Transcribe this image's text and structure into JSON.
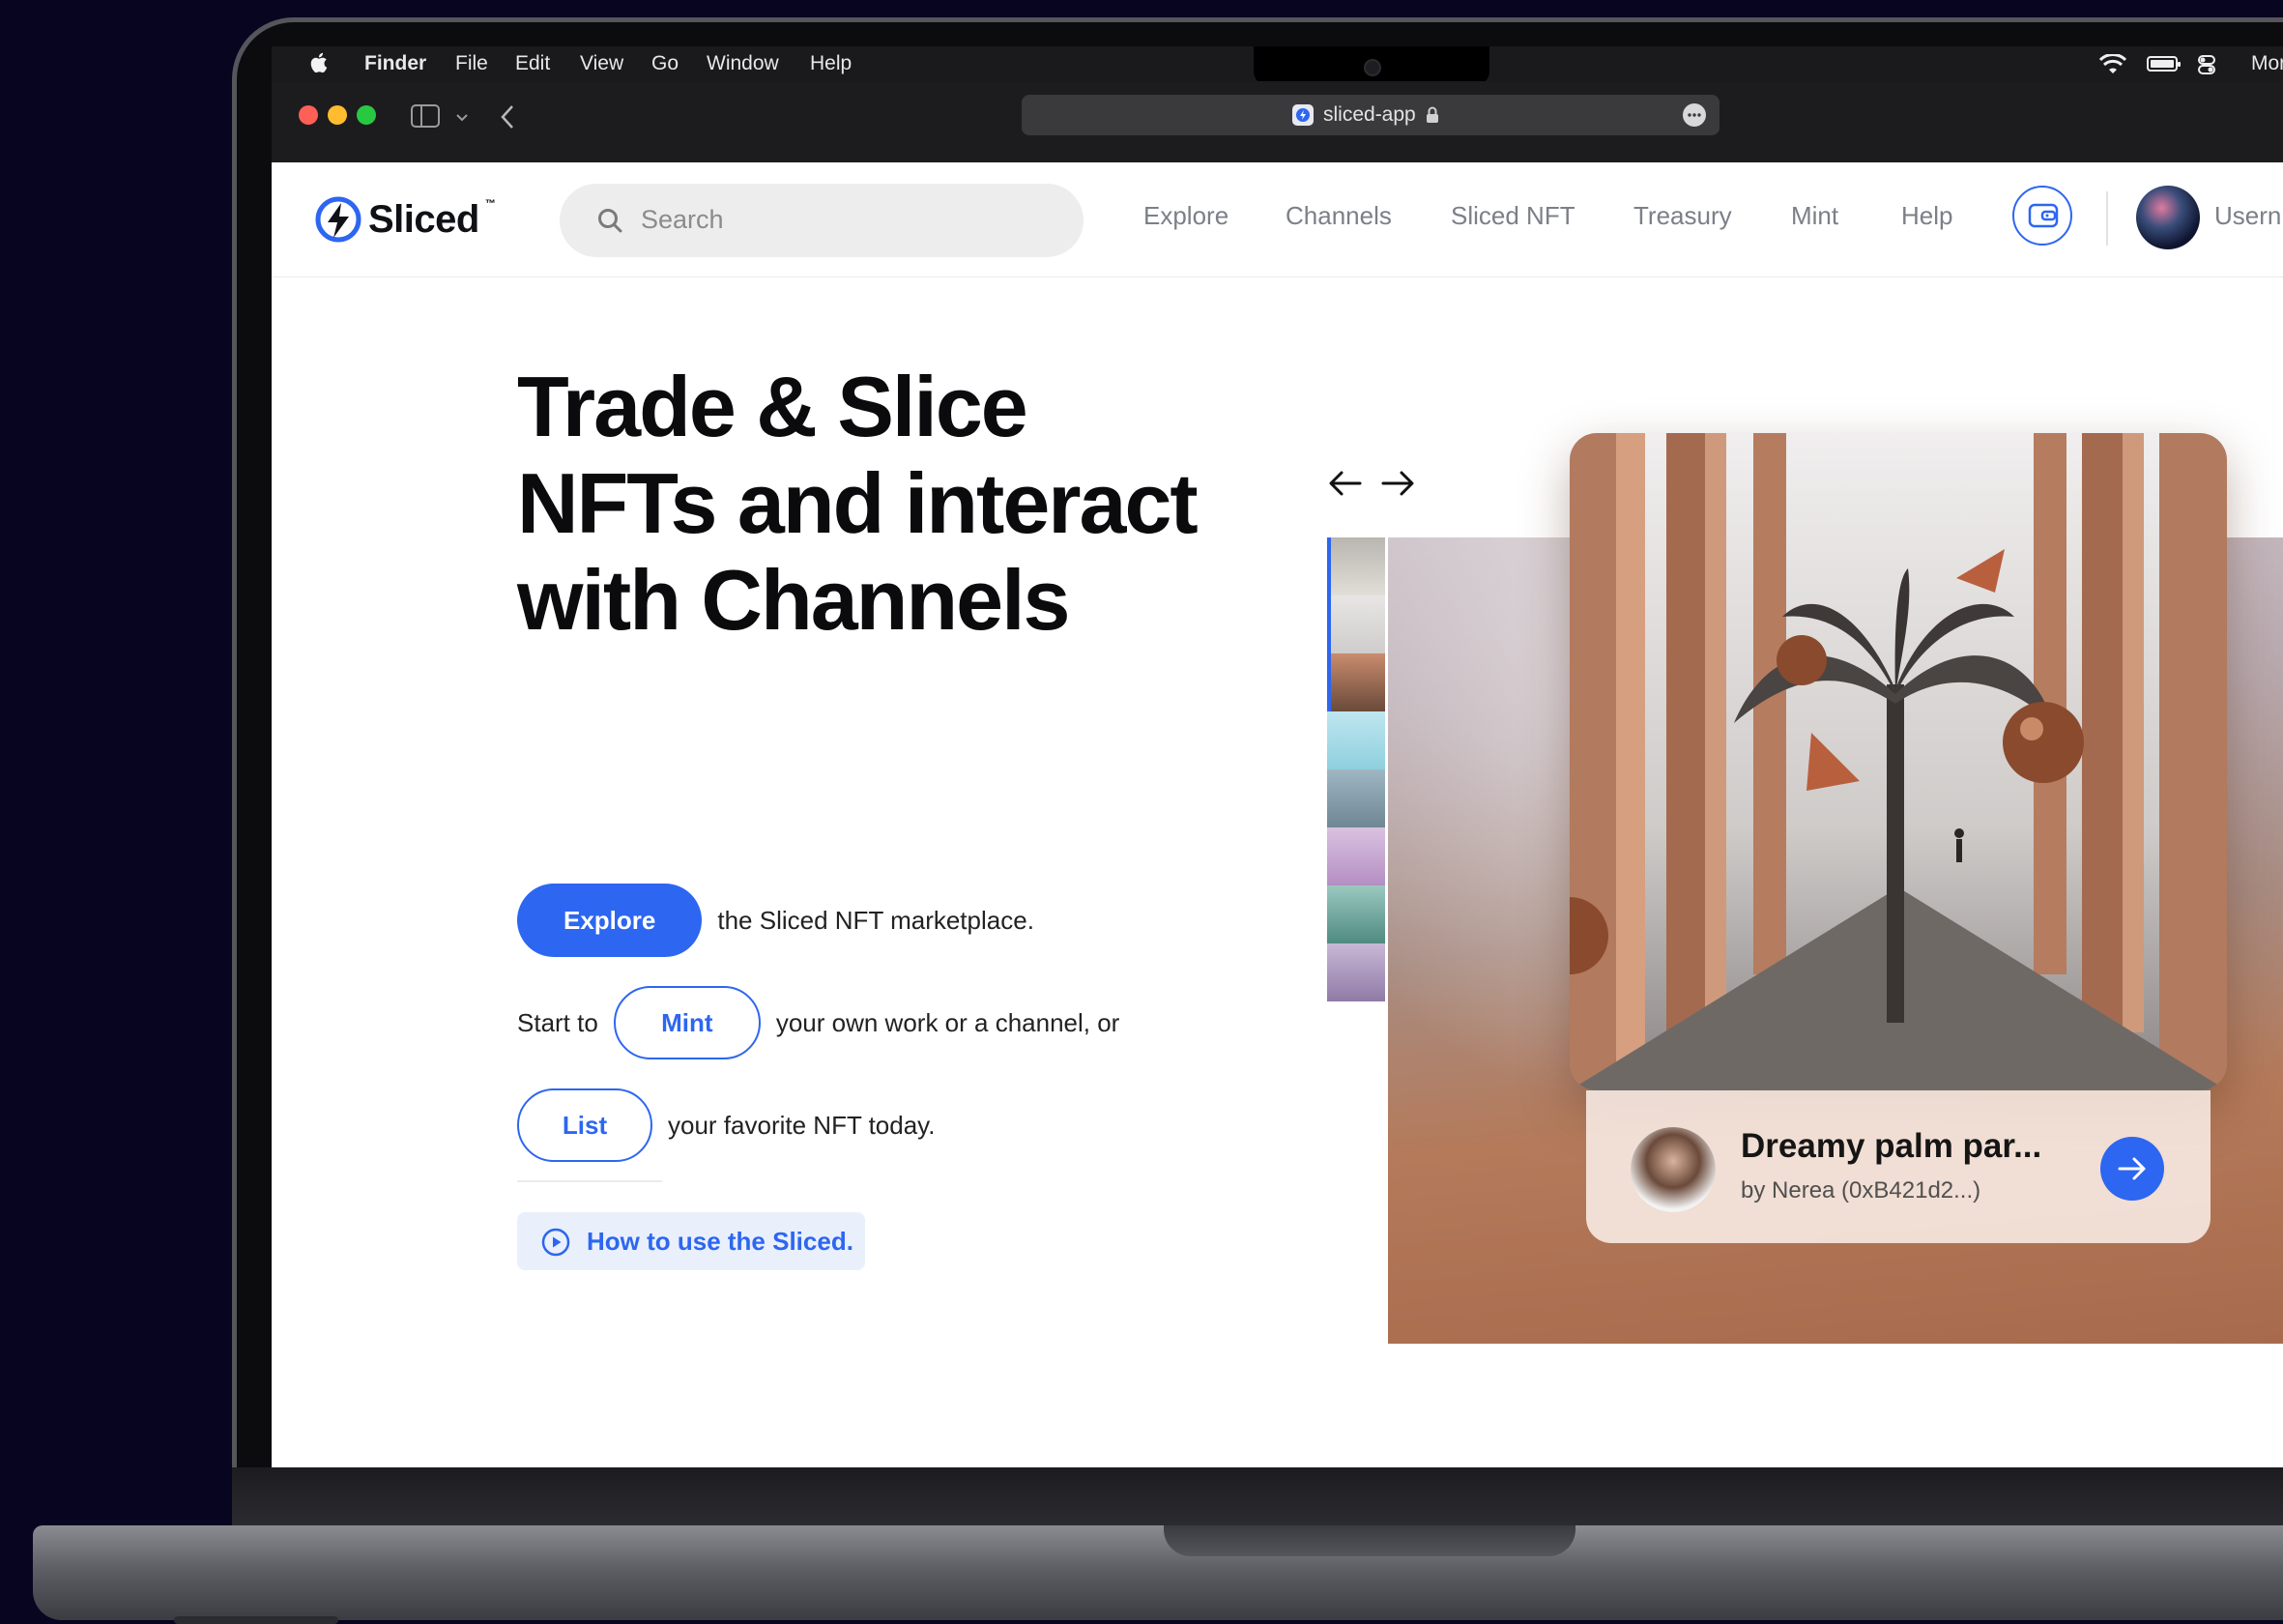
{
  "os_menubar": {
    "items": [
      "Finder",
      "File",
      "Edit",
      "View",
      "Go",
      "Window",
      "Help"
    ],
    "clock_partial": "Mor"
  },
  "browser": {
    "url": "sliced-app"
  },
  "header": {
    "brand": "Sliced",
    "trademark": "™",
    "search_placeholder": "Search",
    "nav": [
      "Explore",
      "Channels",
      "Sliced NFT",
      "Treasury",
      "Mint",
      "Help"
    ],
    "username": "Usern"
  },
  "hero": {
    "headline": [
      "Trade & Slice",
      "NFTs and interact",
      "with Channels"
    ],
    "explore_label": "Explore",
    "explore_text": "the Sliced NFT marketplace.",
    "start_text": "Start to",
    "mint_label": "Mint",
    "mint_text": "your own work or a channel, or",
    "list_label": "List",
    "list_text": "your favorite NFT today.",
    "howto_label": "How to use the Sliced."
  },
  "featured": {
    "title": "Dreamy palm par...",
    "creator": "by Nerea (0xB421d2...)"
  },
  "colors": {
    "accent": "#2d66f0",
    "headline": "#0b0b0e",
    "nav_text": "#7b7f87"
  },
  "icons": {
    "search": "magnifier-icon",
    "wallet": "wallet-icon",
    "prev": "arrow-left-icon",
    "next": "arrow-right-icon",
    "howto": "play-circle-icon",
    "go": "arrow-right-icon"
  }
}
